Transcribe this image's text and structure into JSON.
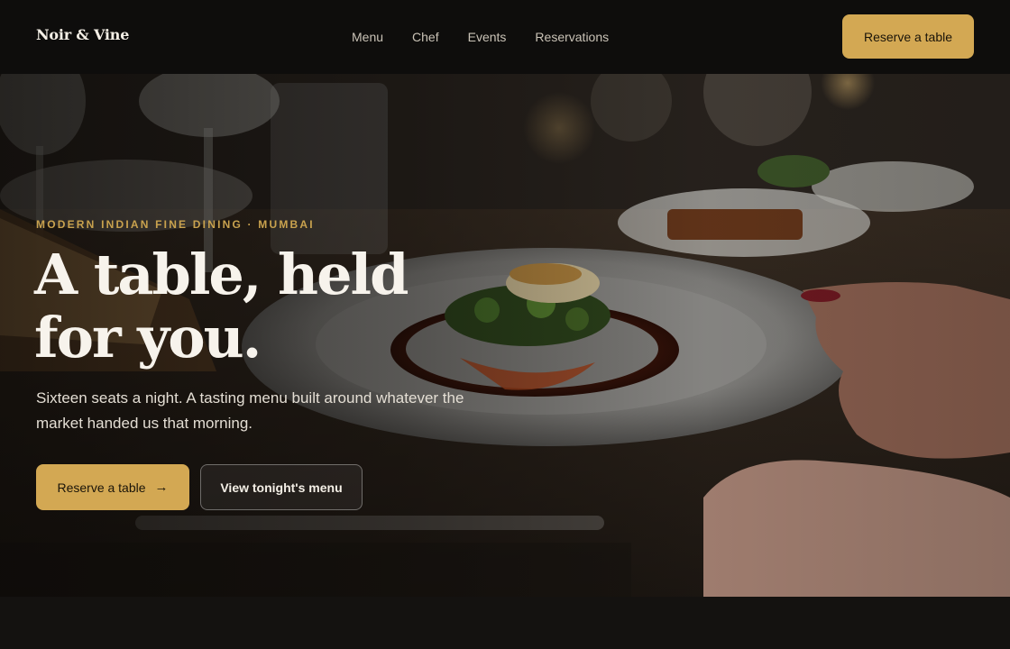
{
  "header": {
    "brand": "Noir & Vine",
    "nav": [
      "Menu",
      "Chef",
      "Events",
      "Reservations"
    ],
    "cta_label": "Reserve a table"
  },
  "hero": {
    "eyebrow": "Modern Indian Fine Dining · Mumbai",
    "headline_line1": "A table, held",
    "headline_line2": "for you.",
    "subcopy": "Sixteen seats a night. A tasting menu built around whatever the market handed us that morning.",
    "primary_cta": "Reserve a table",
    "primary_cta_icon": "arrow-right-icon",
    "secondary_cta": "View tonight's menu"
  },
  "colors": {
    "accent": "#d3a853",
    "header_bg": "#0e0d0c",
    "page_bg": "#13110f",
    "text_light": "#f7f3ec"
  }
}
